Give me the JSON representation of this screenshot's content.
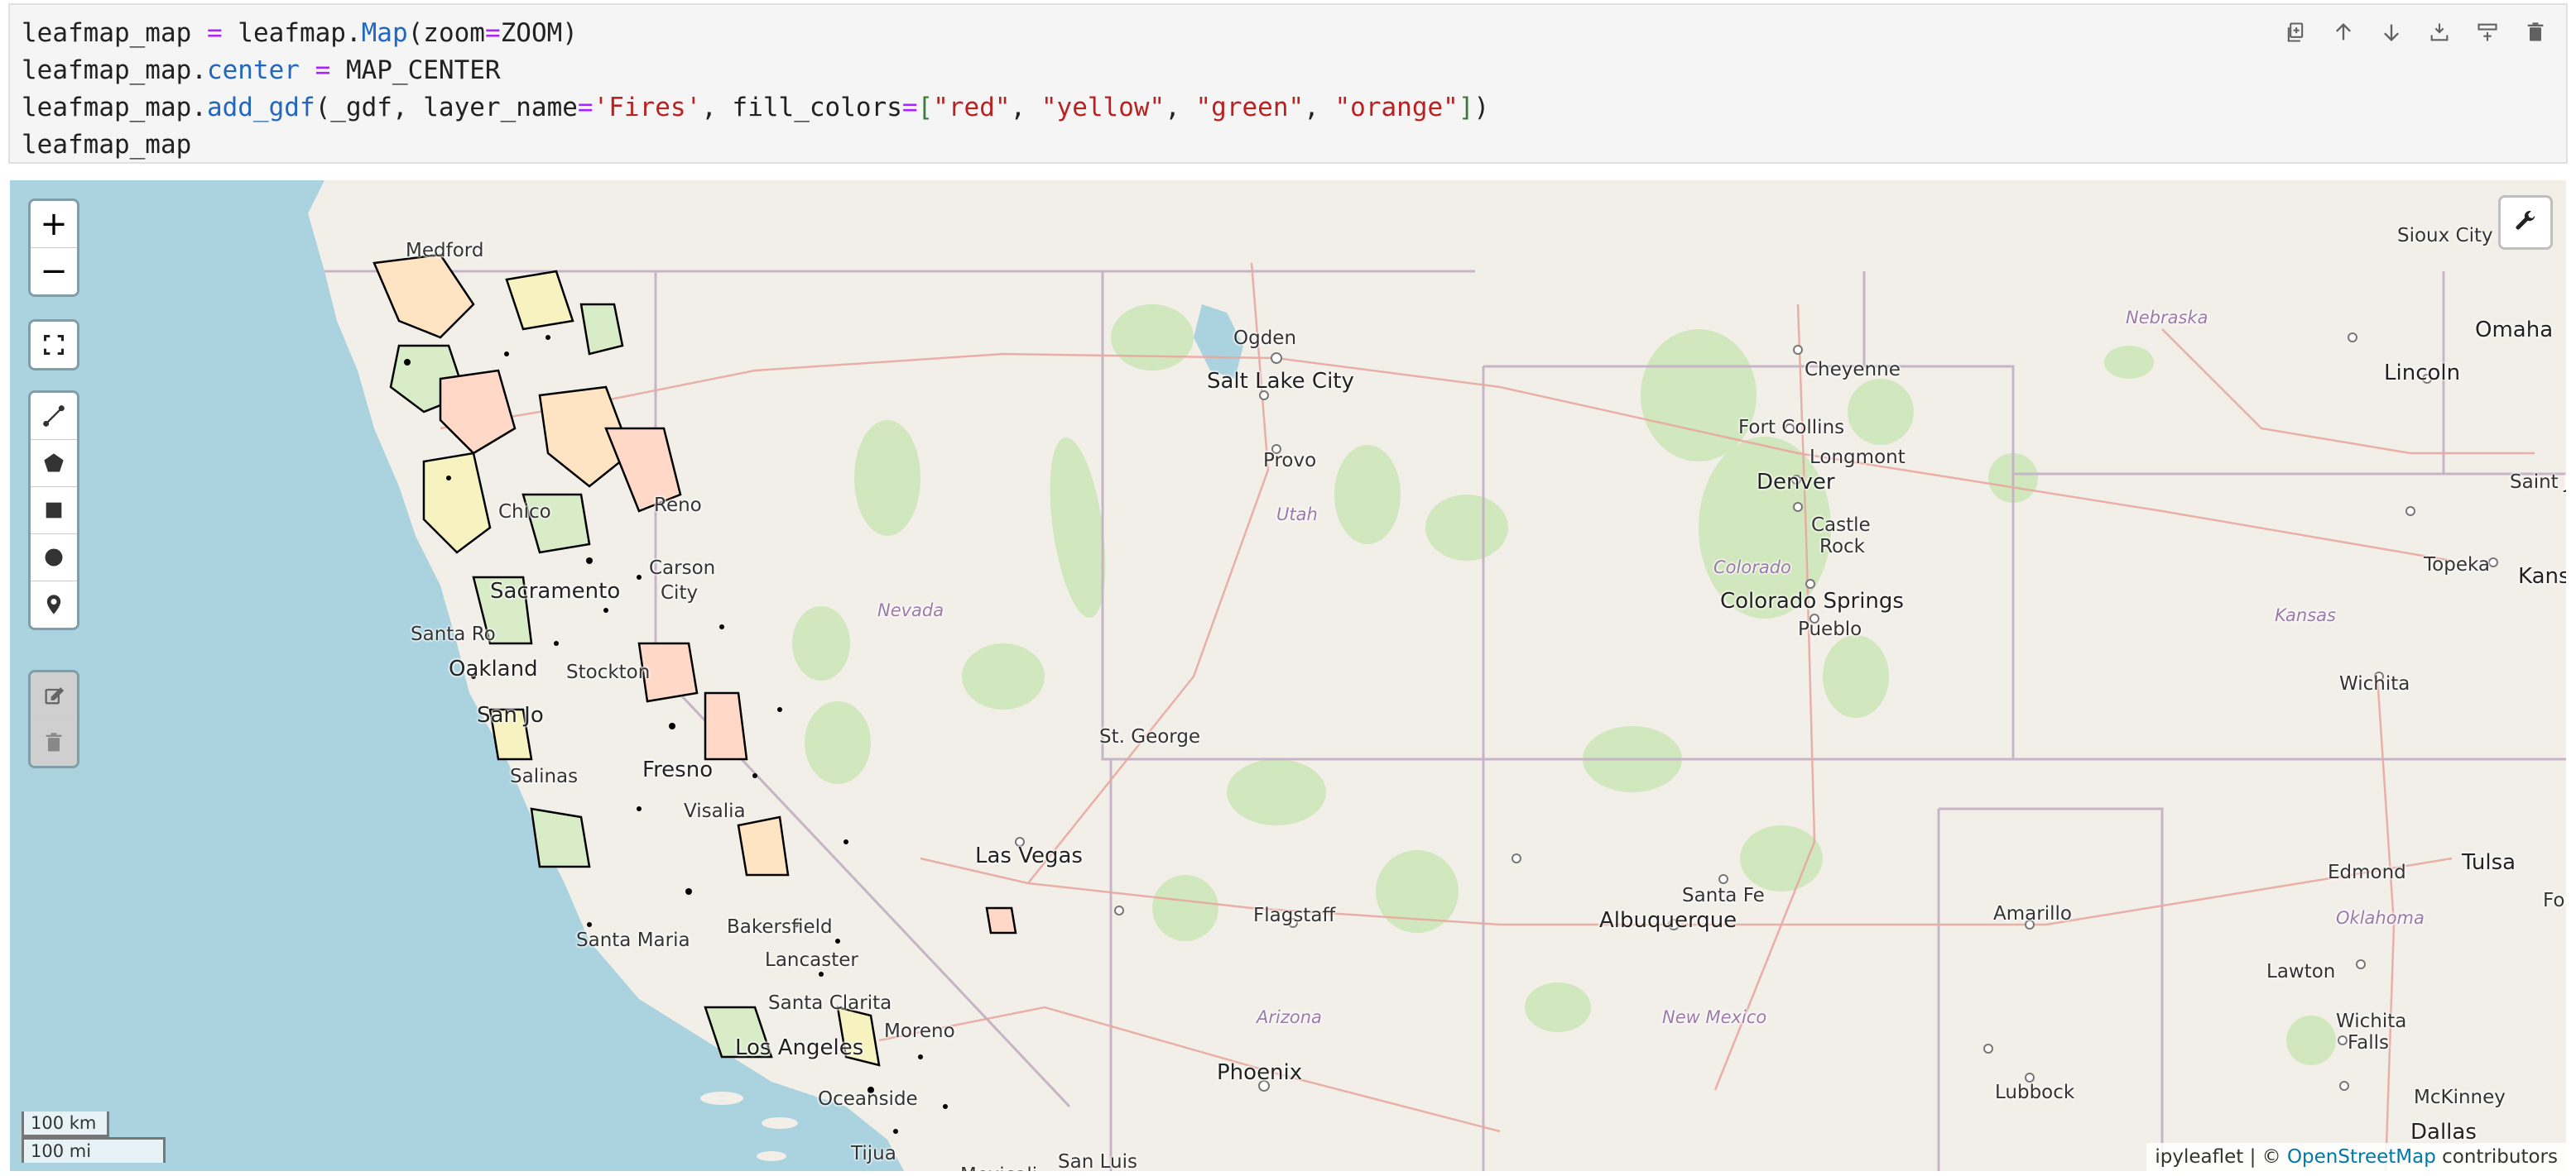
{
  "cell": {
    "code": {
      "l1_a": "leafmap_map ",
      "l1_op": "=",
      "l1_b": " leafmap.",
      "l1_map": "Map",
      "l1_c": "(zoom",
      "l1_eq": "=",
      "l1_d": "ZOOM)",
      "l2_a": "leafmap_map.",
      "l2_center": "center",
      "l2_op": " = ",
      "l2_b": "MAP_CENTER",
      "l3_a": "leafmap_map.",
      "l3_fn": "add_gdf",
      "l3_b": "(_gdf, layer_name",
      "l3_eq": "=",
      "l3_s1": "'Fires'",
      "l3_c": ", fill_colors",
      "l3_eq2": "=",
      "l3_br1": "[",
      "l3_s2": "\"red\"",
      "l3_cm1": ", ",
      "l3_s3": "\"yellow\"",
      "l3_cm2": ", ",
      "l3_s4": "\"green\"",
      "l3_cm3": ", ",
      "l3_s5": "\"orange\"",
      "l3_br2": "]",
      "l3_end": ")",
      "l4": "leafmap_map"
    },
    "toolbar": [
      "duplicate-icon",
      "arrow-up-icon",
      "arrow-down-icon",
      "insert-above-icon",
      "insert-below-icon",
      "delete-icon"
    ]
  },
  "map": {
    "controls": {
      "zoom_in": "+",
      "zoom_out": "−"
    },
    "labels": {
      "medford": "Medford",
      "ogden": "Ogden",
      "salt_lake_city": "Salt Lake City",
      "provo": "Provo",
      "utah": "Utah",
      "reno": "Reno",
      "chico": "Chico",
      "carson": "Carson",
      "city": "City",
      "sacramento": "Sacramento",
      "santa_rosa": "Santa Ro",
      "oakland": "Oakland",
      "stockton": "Stockton",
      "san_jose": "San Jo",
      "salinas": "Salinas",
      "fresno": "Fresno",
      "visalia": "Visalia",
      "nevada": "Nevada",
      "st_george": "St. George",
      "las_vegas": "Las Vegas",
      "bakersfield": "Bakersfield",
      "santa_maria": "Santa Maria",
      "lancaster": "Lancaster",
      "santa_clarita": "Santa Clarita",
      "moreno": "Moreno",
      "los_angeles": "Los Angeles",
      "oceanside": "Oceanside",
      "tijuana": "Tijua",
      "mexicali": "Mexicali",
      "san_luis": "San Luis",
      "flagstaff": "Flagstaff",
      "arizona": "Arizona",
      "phoenix": "Phoenix",
      "albuquerque": "Albuquerque",
      "santa_fe": "Santa Fe",
      "new_mexico": "New Mexico",
      "cheyenne": "Cheyenne",
      "fort_collins": "Fort Collins",
      "longmont": "Longmont",
      "denver": "Denver",
      "castle_rock_1": "Castle",
      "castle_rock_2": "Rock",
      "colorado": "Colorado",
      "colorado_springs": "Colorado Springs",
      "pueblo": "Pueblo",
      "amarillo": "Amarillo",
      "lubbock": "Lubbock",
      "sioux_city": "Sioux City",
      "nebraska": "Nebraska",
      "omaha": "Omaha",
      "lincoln": "Lincoln",
      "saint_jo": "Saint Jo",
      "topeka": "Topeka",
      "kans": "Kans",
      "kansas": "Kansas",
      "wichita": "Wichita",
      "edmond": "Edmond",
      "tulsa": "Tulsa",
      "for": "For",
      "oklahoma": "Oklahoma",
      "lawton": "Lawton",
      "wichita_falls_1": "Wichita",
      "wichita_falls_2": "Falls",
      "mckinney": "McKinney",
      "dallas": "Dallas"
    },
    "scale": {
      "km": "100 km",
      "mi": "100 mi"
    },
    "attribution": {
      "prefix": "ipyleaflet | © ",
      "link": "OpenStreetMap",
      "suffix": " contributors"
    },
    "layer_name": "Fires",
    "fill_colors": [
      "#ff0000",
      "#ffff00",
      "#008000",
      "#ffa500"
    ],
    "ocean_color": "#aad3df",
    "land_color": "#f2efe9"
  }
}
